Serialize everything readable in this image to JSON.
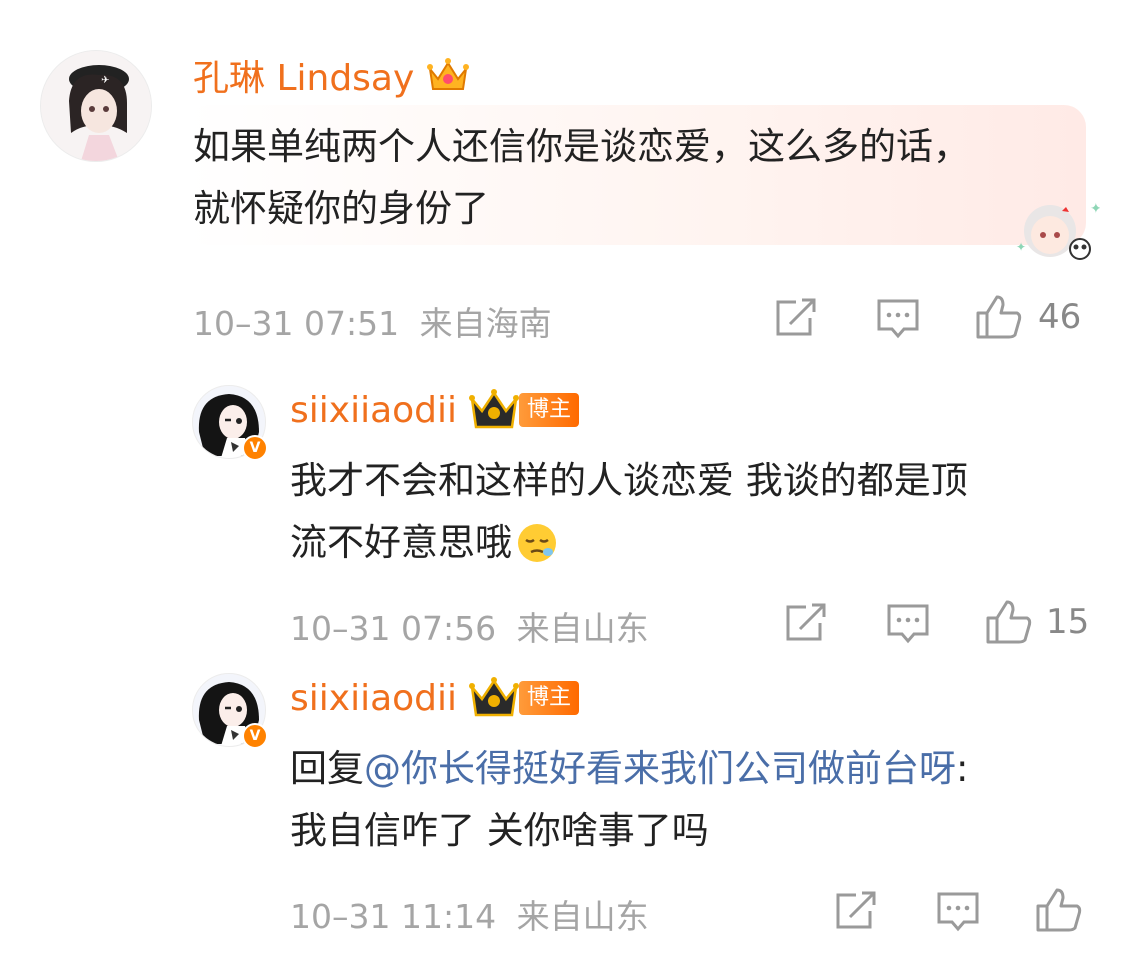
{
  "comments": [
    {
      "username": "孔琳 Lindsay",
      "text_lines": [
        "如果单纯两个人还信你是谈恋爱，这么多的话，",
        "就怀疑你的身份了"
      ],
      "timestamp": "10–31 07:51",
      "location": "来自海南",
      "likes": "46",
      "badge_icon": "vip-crown-icon"
    },
    {
      "username": "siixiiaodii",
      "owner_tag": "博主",
      "text_lines": [
        "我才不会和这样的人谈恋爱 我谈的都是顶",
        "流不好意思哦"
      ],
      "emoji": "sleepy-face-emoji",
      "timestamp": "10–31 07:56",
      "location": "来自山东",
      "likes": "15",
      "verified": "V"
    },
    {
      "username": "siixiiaodii",
      "owner_tag": "博主",
      "reply_prefix": "回复",
      "mention": "@你长得挺好看来我们公司做前台呀",
      "reply_colon": ":",
      "text_line2": "我自信咋了 关你啥事了吗",
      "timestamp": "10–31 11:14",
      "location": "来自山东",
      "verified": "V"
    }
  ],
  "colors": {
    "username": "#f0701d",
    "mention": "#4a6ea8",
    "meta": "#a5a5a5",
    "icon": "#9a9a9a"
  }
}
